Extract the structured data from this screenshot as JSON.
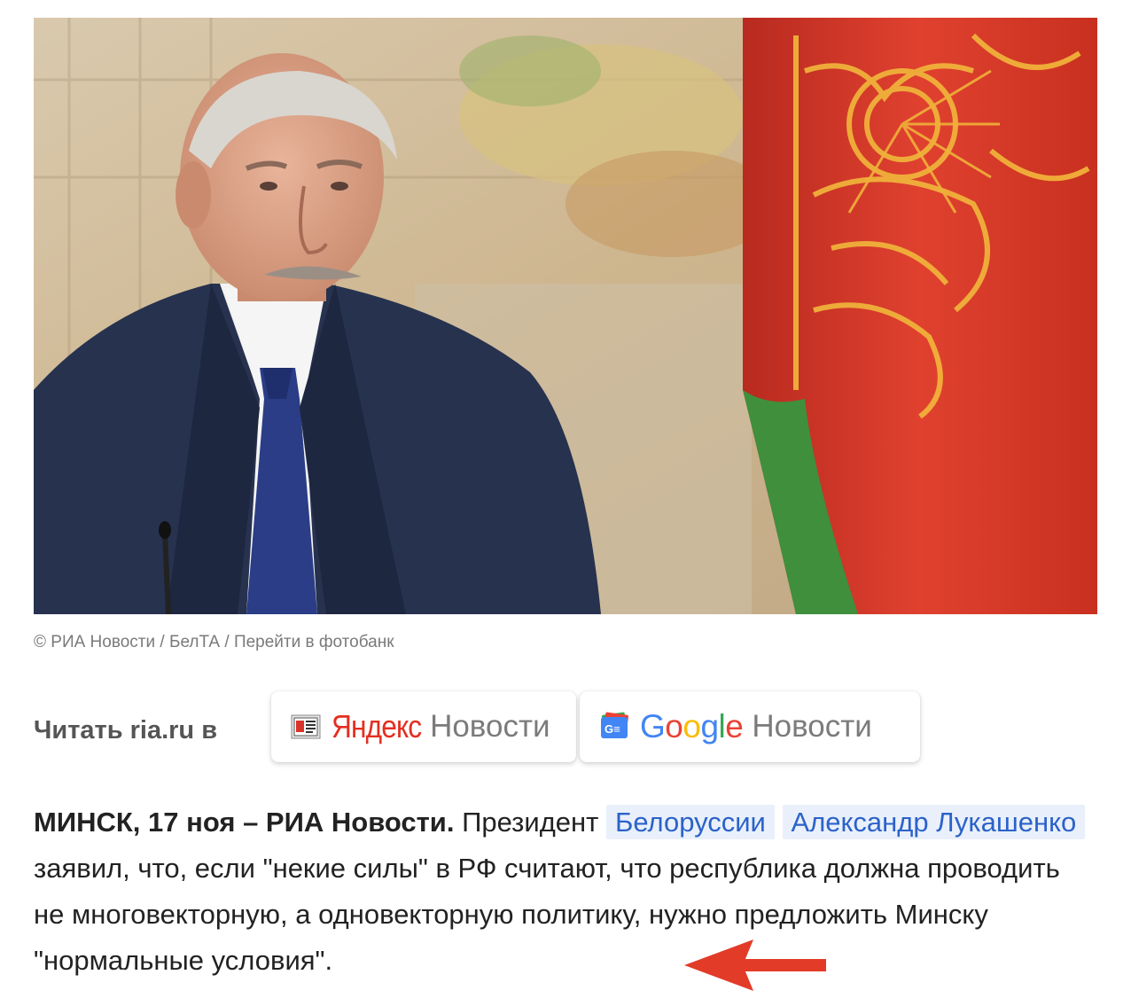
{
  "photo": {
    "alt_subject": "portrait",
    "colors": {
      "suit": "#27324f",
      "flag_red": "#d8352a",
      "flag_green": "#3f8f3c",
      "ornament": "#f0b13a"
    }
  },
  "caption": {
    "copyright": "© РИА Новости",
    "separator": "/",
    "agency": "БелТА",
    "photobank_link": "Перейти в фотобанк"
  },
  "read_in": {
    "label": "Читать ria.ru в",
    "yandex": {
      "brand": "Яндекс",
      "service": "Новости",
      "icon": "newspaper-icon"
    },
    "google": {
      "brand_letters": [
        "G",
        "o",
        "o",
        "g",
        "l",
        "e"
      ],
      "service": "Новости",
      "icon": "google-news-icon",
      "icon_text": "G≡"
    }
  },
  "article": {
    "lead": "МИНСК, 17 ноя – РИА Новости.",
    "text_1": " Президент ",
    "tag_1": "Белоруссии",
    "tag_2": "Александр Лукашенко",
    "text_2": " заявил, что, если \"некие силы\" в РФ считают, что республика должна проводить не многовекторную, а одновекторную политику, нужно предложить Минску \"нормальные условия\"."
  },
  "annotation": {
    "icon": "left-arrow-icon",
    "color": "#e23b28"
  }
}
